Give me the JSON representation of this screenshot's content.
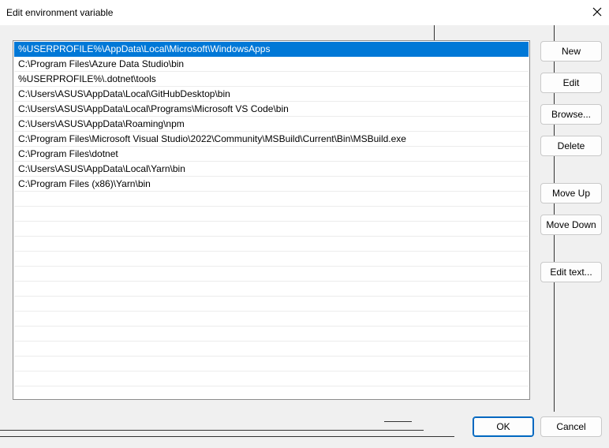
{
  "window": {
    "title": "Edit environment variable"
  },
  "paths": [
    {
      "value": "%USERPROFILE%\\AppData\\Local\\Microsoft\\WindowsApps",
      "selected": true
    },
    {
      "value": "C:\\Program Files\\Azure Data Studio\\bin",
      "selected": false
    },
    {
      "value": "%USERPROFILE%\\.dotnet\\tools",
      "selected": false
    },
    {
      "value": "C:\\Users\\ASUS\\AppData\\Local\\GitHubDesktop\\bin",
      "selected": false
    },
    {
      "value": "C:\\Users\\ASUS\\AppData\\Local\\Programs\\Microsoft VS Code\\bin",
      "selected": false
    },
    {
      "value": "C:\\Users\\ASUS\\AppData\\Roaming\\npm",
      "selected": false
    },
    {
      "value": "C:\\Program Files\\Microsoft Visual Studio\\2022\\Community\\MSBuild\\Current\\Bin\\MSBuild.exe",
      "selected": false
    },
    {
      "value": "C:\\Program Files\\dotnet",
      "selected": false
    },
    {
      "value": "C:\\Users\\ASUS\\AppData\\Local\\Yarn\\bin",
      "selected": false
    },
    {
      "value": "C:\\Program Files (x86)\\Yarn\\bin",
      "selected": false
    }
  ],
  "buttons": {
    "new": "New",
    "edit": "Edit",
    "browse": "Browse...",
    "delete": "Delete",
    "move_up": "Move Up",
    "move_down": "Move Down",
    "edit_text": "Edit text...",
    "ok": "OK",
    "cancel": "Cancel"
  },
  "colors": {
    "selection": "#0078d7",
    "primary_border": "#0067c0"
  }
}
